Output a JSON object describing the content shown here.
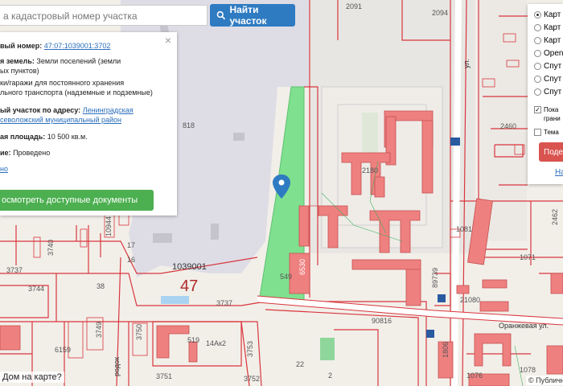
{
  "search": {
    "placeholder": "Введите кадастровый номер участка",
    "value": "а кадастровый номер участка",
    "button_label": "Найти участок"
  },
  "info_panel": {
    "cadastral_label": "вый номер:",
    "cadastral_value": "47:07:1039001:3702",
    "land_label": "я земель:",
    "land_value_1": "Земли поселений (земли",
    "land_value_2": "ых пунктов)",
    "use_1": "ки/гаражи для постоянного хранения",
    "use_2": "льного транспорта (надземные и подземные)",
    "address_label": "ый участок по адресу:",
    "address_value_1": "Ленинградская",
    "address_value_2": "севоложский муниципальный район",
    "area_label": "ая площадь:",
    "area_value": "10 500 кв.м.",
    "status_label": "ие:",
    "status_value": "Проведено",
    "more_link": "но",
    "docs_button": "осмотреть доступные документы"
  },
  "layers": {
    "options": [
      "Карт",
      "Карт",
      "Карт",
      "Open",
      "Спут",
      "Спут",
      "Спут"
    ],
    "selected_index": 0,
    "checkboxes": [
      {
        "label_1": "Пока",
        "label_2": "грани",
        "checked": true
      },
      {
        "label_1": "Тема",
        "label_2": "",
        "checked": false
      }
    ],
    "button_label": "Поде",
    "link_label": "На"
  },
  "map_labels": {
    "parcels": [
      "2091",
      "2094",
      "818",
      "2180",
      "2460",
      "1081",
      "1071",
      "3744",
      "3740",
      "3737",
      "3737",
      "38",
      "16",
      "10944",
      "17",
      "1039001",
      "47",
      "549",
      "6530",
      "21080",
      "89739",
      "90816",
      "3749",
      "3750",
      "519",
      "14Ак2",
      "3751",
      "22",
      "6159",
      "2462",
      "1076",
      "3752",
      "2",
      "1078",
      "1806",
      "3753"
    ],
    "street_orange": "Оранжевая ул.",
    "street_side": "ул.",
    "street_bottom": "родок"
  },
  "bottom_question": "Дом на карте?",
  "attribution": "© Публичн",
  "colors": {
    "parcel_line": "#d9363e",
    "building": "#ef8080",
    "highlight": "#7fe08f",
    "accent_button": "#2f7bc2",
    "docs_button": "#4caf50",
    "layer_button": "#d9534f"
  }
}
